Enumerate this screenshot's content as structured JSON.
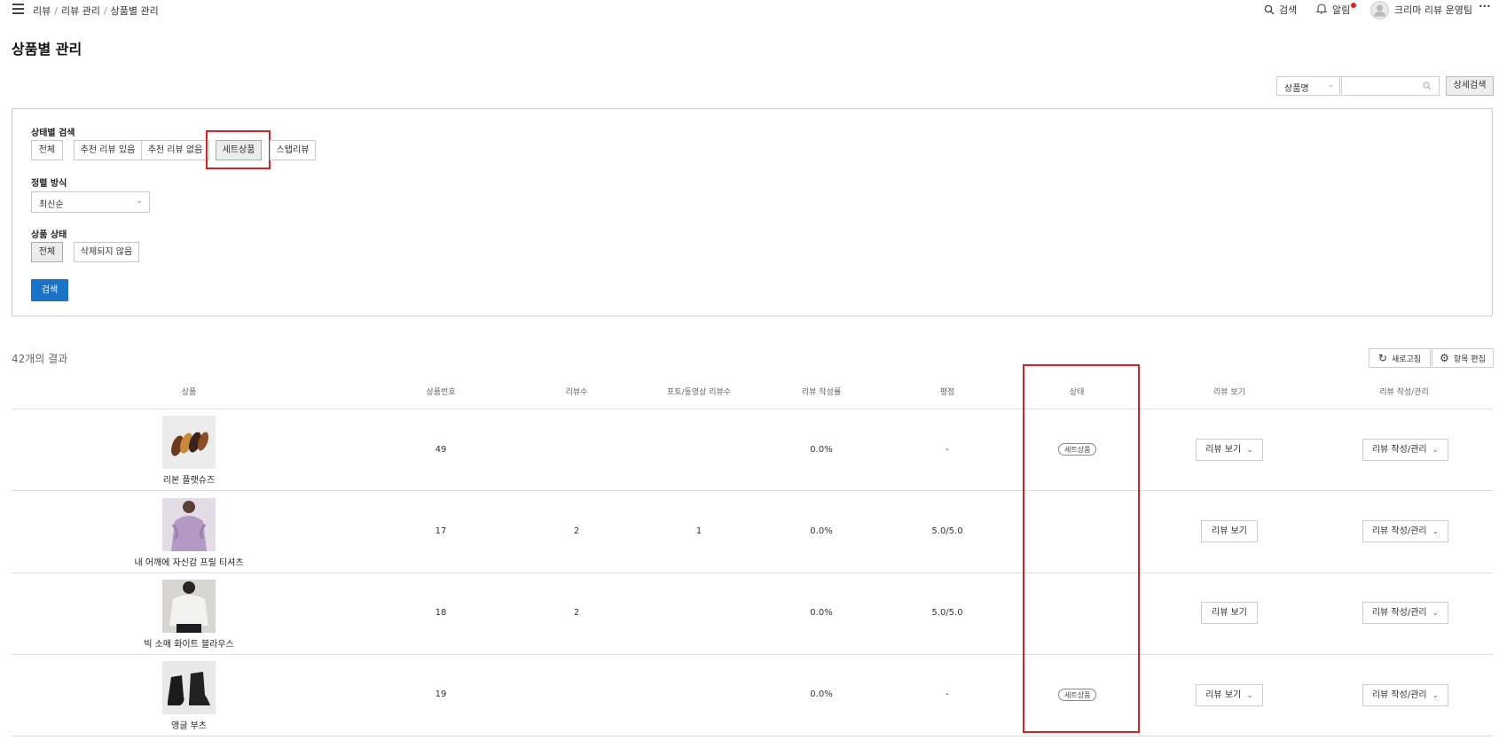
{
  "header": {
    "breadcrumb": [
      "리뷰",
      "리뷰 관리",
      "상품별 관리"
    ],
    "search_label": "검색",
    "notify_label": "알림",
    "user_label": "크리마 리뷰 운영팀",
    "more_label": "···"
  },
  "page_title": "상품별 관리",
  "top_search": {
    "select_value": "상품명",
    "input_value": "",
    "detail_button": "상세검색"
  },
  "filters": {
    "status_label": "상태별 검색",
    "status_options": [
      "전체",
      "추천 리뷰 있음",
      "추천 리뷰 없음",
      "세트상품",
      "스탭리뷰"
    ],
    "sort_label": "정렬 방식",
    "sort_value": "최신순",
    "product_status_label": "상품 상태",
    "product_status_options": [
      "전체",
      "삭제되지 않음"
    ],
    "search_button": "검색"
  },
  "results": {
    "count_text": "42개의 결과",
    "refresh_button": "새로고침",
    "edit_columns_button": "항목 편집"
  },
  "table": {
    "columns": [
      "상품",
      "상품번호",
      "리뷰수",
      "포토/동영상 리뷰수",
      "리뷰 작성률",
      "평점",
      "상태",
      "리뷰 보기",
      "리뷰 작성/관리"
    ],
    "rows": [
      {
        "name": "리본 플랫슈즈",
        "number": "49",
        "reviews": "",
        "photo_reviews": "",
        "rate": "0.0%",
        "score": "-",
        "status": "세트상품",
        "view": "리뷰 보기",
        "manage": "리뷰 작성/관리",
        "thumb": "shoes-thumbnail"
      },
      {
        "name": "내 어깨에 자신감 프릴 티셔츠",
        "number": "17",
        "reviews": "2",
        "photo_reviews": "1",
        "rate": "0.0%",
        "score": "5.0/5.0",
        "status": "",
        "view": "리뷰 보기",
        "manage": "리뷰 작성/관리",
        "thumb": "shirt-thumbnail"
      },
      {
        "name": "빅 소매 화이트 블라우스",
        "number": "18",
        "reviews": "2",
        "photo_reviews": "",
        "rate": "0.0%",
        "score": "5.0/5.0",
        "status": "",
        "view": "리뷰 보기",
        "manage": "리뷰 작성/관리",
        "thumb": "blouse-thumbnail"
      },
      {
        "name": "앵글 부츠",
        "number": "19",
        "reviews": "",
        "photo_reviews": "",
        "rate": "0.0%",
        "score": "-",
        "status": "세트상품",
        "view": "리뷰 보기",
        "manage": "리뷰 작성/관리",
        "thumb": "boots-thumbnail"
      }
    ]
  },
  "colors": {
    "primary": "#1a73c9",
    "highlight_border": "#e02020",
    "notification_dot": "#e02020"
  }
}
